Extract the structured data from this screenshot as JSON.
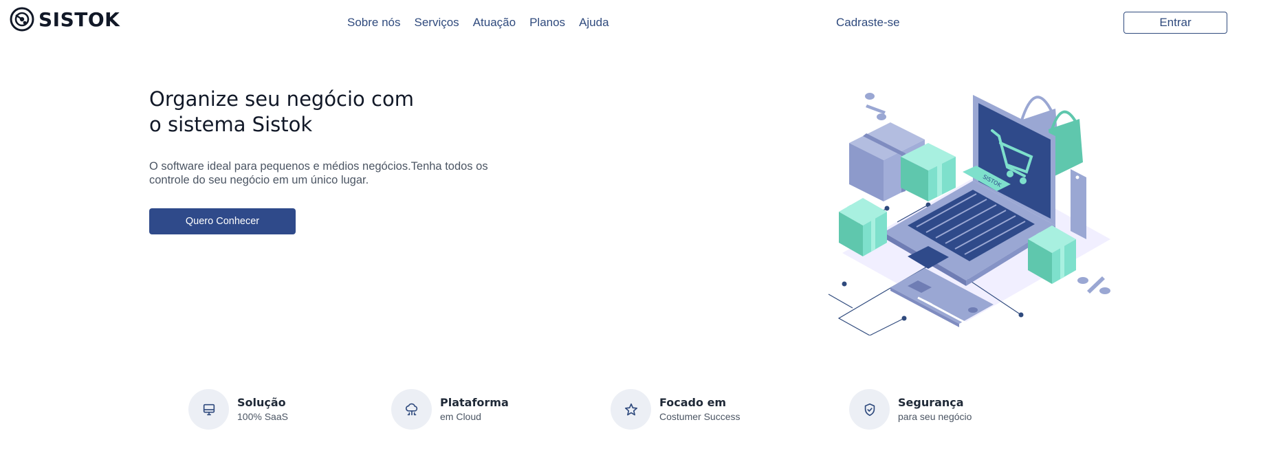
{
  "header": {
    "brand": "SISTOK",
    "nav": [
      "Sobre nós",
      "Serviços",
      "Atuação",
      "Planos",
      "Ajuda"
    ],
    "signup_label": "Cadraste-se",
    "login_label": "Entrar"
  },
  "hero": {
    "title_line1": "Organize seu negócio com",
    "title_line2": "o sistema Sistok",
    "subtitle_line1": "O software ideal para pequenos e médios negócios.Tenha todos os",
    "subtitle_line2": "controle do seu negócio em um único lugar.",
    "cta_label": "Quero Conhecer",
    "illustration_badge": "SISTOK"
  },
  "features": [
    {
      "icon": "monitor-icon",
      "title": "Solução",
      "subtitle": "100% SaaS"
    },
    {
      "icon": "cloud-icon",
      "title": "Plataforma",
      "subtitle": "em Cloud"
    },
    {
      "icon": "star-icon",
      "title": "Focado em",
      "subtitle": "Costumer Success"
    },
    {
      "icon": "shield-icon",
      "title": "Segurança",
      "subtitle": "para seu negócio"
    }
  ],
  "colors": {
    "primary": "#2f4a8a",
    "nav_text": "#2f4a7d",
    "accent_mint": "#7ee0cc",
    "illustration_lavender": "#9aa7d3",
    "feature_circle": "#eceff5"
  }
}
